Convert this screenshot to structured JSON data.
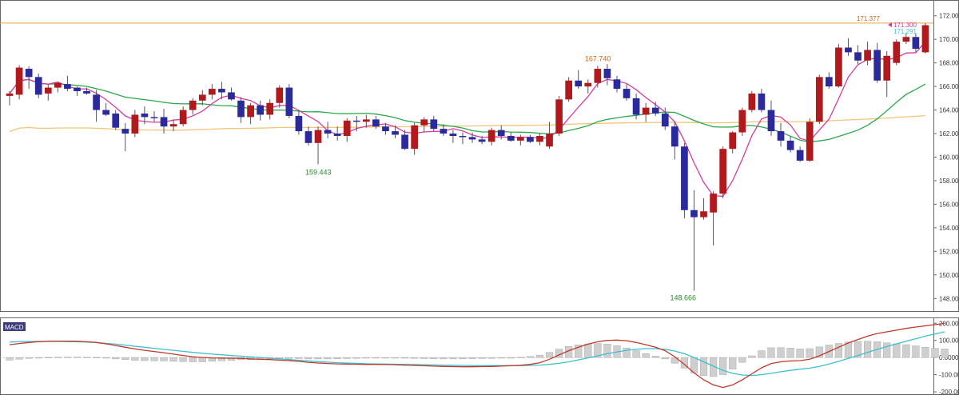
{
  "colors": {
    "up": "#b2191c",
    "down": "#2a2a9c",
    "ma_short": "#d63aa6",
    "ma_mid": "#2aa84a",
    "ma_long": "#f2c476",
    "hline": "#e0a44a",
    "macd_line": "#c0392b",
    "signal_line": "#3cc0d0",
    "histogram": "#cfcfcf",
    "macd_label_bg": "#3c3c7a",
    "frame": "#666666"
  },
  "chart_data": [
    {
      "type": "candlestick",
      "ylim": [
        147,
        173
      ],
      "y_ticks": [
        "172.000",
        "170.000",
        "168.000",
        "166.000",
        "164.000",
        "162.000",
        "160.000",
        "158.000",
        "156.000",
        "154.000",
        "152.000",
        "150.000",
        "148.000"
      ],
      "grid": false,
      "annotations": {
        "high_label": "167.740",
        "low_label_1": "159.443",
        "low_label_2": "148.666",
        "hline_value_label": "171.377",
        "price_label_1": "171.300",
        "price_label_2": "171.291"
      },
      "hline": 171.377,
      "candles": [
        [
          165.2,
          165.6,
          164.4,
          165.4
        ],
        [
          165.3,
          167.8,
          164.9,
          167.6
        ],
        [
          167.5,
          167.7,
          165.8,
          166.8
        ],
        [
          166.8,
          167.1,
          165.0,
          165.3
        ],
        [
          165.4,
          166.2,
          164.8,
          165.9
        ],
        [
          165.9,
          166.4,
          165.5,
          166.3
        ],
        [
          166.2,
          166.9,
          165.6,
          165.8
        ],
        [
          165.9,
          166.0,
          165.2,
          165.6
        ],
        [
          165.6,
          165.9,
          165.3,
          165.4
        ],
        [
          165.3,
          165.7,
          163.0,
          164.0
        ],
        [
          164.0,
          164.6,
          163.5,
          163.6
        ],
        [
          163.7,
          164.0,
          162.3,
          162.5
        ],
        [
          162.4,
          162.9,
          160.5,
          162.0
        ],
        [
          162.0,
          164.0,
          161.7,
          163.6
        ],
        [
          163.7,
          164.3,
          162.8,
          163.4
        ],
        [
          163.4,
          163.9,
          163.0,
          163.3
        ],
        [
          163.4,
          164.1,
          162.0,
          162.6
        ],
        [
          162.6,
          163.2,
          162.2,
          162.8
        ],
        [
          162.8,
          164.3,
          162.6,
          164.0
        ],
        [
          164.0,
          165.0,
          163.6,
          164.8
        ],
        [
          164.8,
          165.7,
          164.4,
          165.3
        ],
        [
          165.3,
          166.2,
          164.9,
          165.8
        ],
        [
          165.8,
          166.4,
          164.9,
          165.5
        ],
        [
          165.5,
          165.9,
          164.8,
          164.9
        ],
        [
          164.8,
          165.1,
          162.9,
          163.4
        ],
        [
          163.4,
          164.6,
          162.8,
          164.4
        ],
        [
          164.4,
          164.8,
          163.1,
          163.6
        ],
        [
          163.6,
          164.9,
          163.2,
          164.6
        ],
        [
          164.6,
          166.1,
          164.2,
          165.9
        ],
        [
          165.9,
          166.2,
          163.3,
          163.5
        ],
        [
          163.5,
          164.0,
          161.9,
          162.2
        ],
        [
          162.2,
          162.6,
          161.0,
          161.2
        ],
        [
          161.2,
          162.6,
          159.4,
          162.3
        ],
        [
          162.3,
          163.0,
          161.6,
          162.0
        ],
        [
          162.0,
          162.6,
          161.4,
          161.8
        ],
        [
          161.8,
          163.3,
          161.3,
          163.1
        ],
        [
          163.1,
          163.5,
          162.2,
          163.0
        ],
        [
          163.0,
          163.6,
          162.5,
          163.2
        ],
        [
          163.2,
          163.5,
          162.4,
          162.6
        ],
        [
          162.6,
          162.9,
          161.9,
          162.2
        ],
        [
          162.2,
          162.7,
          161.6,
          161.9
        ],
        [
          161.9,
          162.3,
          160.6,
          160.7
        ],
        [
          160.7,
          162.9,
          160.2,
          162.7
        ],
        [
          162.7,
          163.4,
          162.1,
          163.2
        ],
        [
          163.2,
          163.5,
          162.2,
          162.4
        ],
        [
          162.4,
          162.8,
          161.8,
          162.0
        ],
        [
          162.0,
          162.3,
          161.2,
          161.8
        ],
        [
          161.8,
          162.1,
          161.1,
          161.7
        ],
        [
          161.7,
          162.1,
          161.2,
          161.5
        ],
        [
          161.5,
          161.8,
          161.1,
          161.3
        ],
        [
          161.3,
          162.5,
          161.0,
          162.3
        ],
        [
          162.3,
          162.7,
          161.5,
          161.8
        ],
        [
          161.8,
          162.1,
          161.3,
          161.4
        ],
        [
          161.4,
          161.9,
          161.0,
          161.7
        ],
        [
          161.7,
          161.9,
          161.2,
          161.3
        ],
        [
          161.3,
          162.0,
          161.0,
          161.8
        ],
        [
          160.9,
          163.0,
          160.7,
          162.0
        ],
        [
          162.0,
          165.2,
          161.8,
          164.9
        ],
        [
          164.9,
          166.8,
          164.7,
          166.5
        ],
        [
          166.5,
          167.4,
          165.8,
          166.0
        ],
        [
          166.0,
          166.6,
          165.4,
          166.3
        ],
        [
          166.3,
          167.74,
          165.9,
          167.5
        ],
        [
          167.5,
          167.9,
          166.1,
          166.7
        ],
        [
          166.6,
          166.9,
          165.5,
          165.8
        ],
        [
          165.8,
          166.2,
          164.8,
          165.0
        ],
        [
          165.0,
          165.4,
          163.2,
          163.6
        ],
        [
          163.6,
          164.6,
          163.0,
          164.2
        ],
        [
          164.2,
          164.7,
          163.5,
          163.7
        ],
        [
          163.7,
          164.2,
          162.3,
          162.6
        ],
        [
          162.6,
          163.0,
          159.8,
          160.9
        ],
        [
          160.9,
          161.2,
          154.8,
          155.5
        ],
        [
          155.5,
          157.2,
          148.666,
          154.9
        ],
        [
          154.9,
          156.5,
          154.7,
          155.4
        ],
        [
          155.3,
          157.1,
          152.5,
          156.9
        ],
        [
          156.9,
          160.9,
          156.5,
          160.7
        ],
        [
          160.7,
          162.2,
          160.3,
          162.1
        ],
        [
          162.1,
          164.2,
          161.8,
          164.0
        ],
        [
          164.0,
          165.6,
          163.8,
          165.4
        ],
        [
          165.4,
          165.8,
          163.8,
          164.0
        ],
        [
          164.0,
          164.8,
          161.8,
          162.2
        ],
        [
          162.2,
          162.9,
          160.9,
          161.4
        ],
        [
          161.4,
          161.8,
          160.4,
          160.6
        ],
        [
          160.6,
          160.9,
          159.6,
          159.7
        ],
        [
          159.7,
          163.3,
          159.6,
          163.0
        ],
        [
          163.0,
          167.0,
          162.8,
          166.8
        ],
        [
          166.8,
          167.2,
          165.8,
          166.0
        ],
        [
          166.0,
          169.6,
          165.9,
          169.3
        ],
        [
          169.3,
          170.1,
          168.6,
          168.9
        ],
        [
          168.9,
          169.5,
          167.9,
          168.2
        ],
        [
          168.2,
          169.8,
          167.8,
          169.1
        ],
        [
          169.1,
          169.7,
          166.3,
          166.5
        ],
        [
          166.5,
          169.0,
          165.1,
          168.6
        ],
        [
          168.0,
          170.0,
          167.8,
          169.8
        ],
        [
          169.8,
          170.5,
          169.6,
          170.2
        ],
        [
          170.2,
          170.5,
          168.9,
          169.2
        ],
        [
          168.9,
          171.377,
          168.8,
          171.2
        ]
      ]
    },
    {
      "type": "macd",
      "label": "MACD",
      "ylim": [
        -200,
        220
      ],
      "y_ticks": [
        "200.0000",
        "100.0000",
        "0.0000",
        "-100.0000",
        "-200.0000"
      ],
      "macd": [
        75,
        82,
        88,
        92,
        95,
        96,
        96,
        95,
        92,
        88,
        80,
        70,
        60,
        50,
        42,
        35,
        28,
        20,
        12,
        5,
        0,
        -2,
        -3,
        -4,
        -5,
        -8,
        -10,
        -12,
        -15,
        -18,
        -22,
        -28,
        -32,
        -35,
        -37,
        -38,
        -39,
        -40,
        -40,
        -41,
        -42,
        -44,
        -46,
        -48,
        -50,
        -52,
        -53,
        -54,
        -54,
        -53,
        -52,
        -50,
        -48,
        -45,
        -40,
        -30,
        -10,
        15,
        40,
        60,
        78,
        92,
        100,
        102,
        98,
        88,
        75,
        60,
        40,
        5,
        -40,
        -90,
        -130,
        -160,
        -175,
        -160,
        -130,
        -95,
        -60,
        -35,
        -25,
        -20,
        -18,
        -10,
        10,
        35,
        60,
        85,
        105,
        125,
        140,
        150,
        160,
        170,
        178,
        185,
        192,
        200
      ],
      "signal": [
        90,
        92,
        93,
        94,
        94,
        94,
        93,
        92,
        90,
        87,
        83,
        78,
        72,
        66,
        60,
        54,
        48,
        42,
        36,
        30,
        25,
        20,
        16,
        12,
        8,
        4,
        0,
        -4,
        -8,
        -12,
        -16,
        -20,
        -24,
        -27,
        -30,
        -32,
        -34,
        -36,
        -37,
        -38,
        -39,
        -40,
        -41,
        -42,
        -43,
        -44,
        -45,
        -46,
        -47,
        -47,
        -47,
        -47,
        -47,
        -47,
        -46,
        -44,
        -40,
        -34,
        -25,
        -14,
        -2,
        10,
        22,
        33,
        42,
        48,
        52,
        52,
        48,
        38,
        22,
        0,
        -25,
        -50,
        -75,
        -92,
        -102,
        -105,
        -100,
        -92,
        -83,
        -75,
        -68,
        -62,
        -52,
        -38,
        -22,
        -5,
        12,
        30,
        48,
        64,
        80,
        95,
        110,
        125,
        138,
        150
      ]
    }
  ]
}
